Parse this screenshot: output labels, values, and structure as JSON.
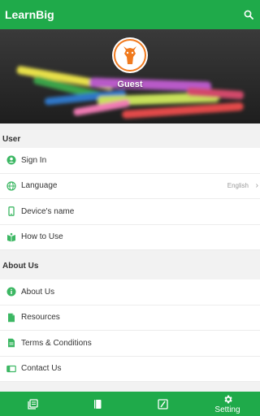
{
  "appbar": {
    "title": "LearnBig",
    "search_icon": "search-icon"
  },
  "profile": {
    "name": "Guest",
    "avatar_icon": "giraffe-icon"
  },
  "sections": {
    "user": {
      "title": "User",
      "items": [
        {
          "label": "Sign In",
          "icon": "account-icon"
        },
        {
          "label": "Language",
          "icon": "globe-icon",
          "value": "English"
        },
        {
          "label": "Device's name",
          "icon": "phone-icon"
        },
        {
          "label": "How to Use",
          "icon": "book-open-icon"
        }
      ]
    },
    "about": {
      "title": "About Us",
      "items": [
        {
          "label": "About Us",
          "icon": "info-icon"
        },
        {
          "label": "Resources",
          "icon": "file-icon"
        },
        {
          "label": "Terms & Conditions",
          "icon": "document-icon"
        },
        {
          "label": "Contact Us",
          "icon": "card-icon"
        }
      ]
    }
  },
  "bottom_nav": {
    "tabs": [
      {
        "icon": "library-icon",
        "label": ""
      },
      {
        "icon": "book-icon",
        "label": ""
      },
      {
        "icon": "edit-icon",
        "label": ""
      },
      {
        "icon": "gear-icon",
        "label": "Setting",
        "active": true
      }
    ]
  },
  "colors": {
    "primary": "#1faa4a",
    "icon_green": "#3cb763"
  }
}
